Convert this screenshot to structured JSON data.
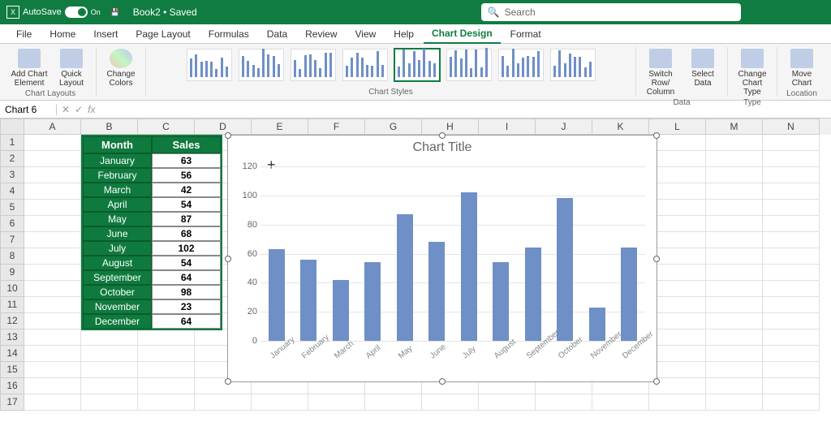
{
  "titlebar": {
    "autosave_label": "AutoSave",
    "autosave_state": "On",
    "doc_name": "Book2 • Saved",
    "search_placeholder": "Search"
  },
  "menubar": {
    "tabs": [
      "File",
      "Home",
      "Insert",
      "Page Layout",
      "Formulas",
      "Data",
      "Review",
      "View",
      "Help",
      "Chart Design",
      "Format"
    ],
    "active": "Chart Design"
  },
  "ribbon": {
    "groups": {
      "chart_layouts": {
        "label": "Chart Layouts",
        "buttons": [
          "Add Chart Element",
          "Quick Layout"
        ]
      },
      "change_colors": {
        "label": "",
        "buttons": [
          "Change Colors"
        ]
      },
      "chart_styles": {
        "label": "Chart Styles"
      },
      "data": {
        "label": "Data",
        "buttons": [
          "Switch Row/ Column",
          "Select Data"
        ]
      },
      "type": {
        "label": "Type",
        "buttons": [
          "Change Chart Type"
        ]
      },
      "location": {
        "label": "Location",
        "buttons": [
          "Move Chart"
        ]
      }
    }
  },
  "namebox": "Chart 6",
  "fx_label": "fx",
  "columns": [
    "A",
    "B",
    "C",
    "D",
    "E",
    "F",
    "G",
    "H",
    "I",
    "J",
    "K",
    "L",
    "M",
    "N"
  ],
  "row_numbers": [
    1,
    2,
    3,
    4,
    5,
    6,
    7,
    8,
    9,
    10,
    11,
    12,
    13,
    14,
    15,
    16,
    17
  ],
  "table": {
    "headers": [
      "Month",
      "Sales"
    ],
    "rows": [
      {
        "m": "January",
        "v": 63
      },
      {
        "m": "February",
        "v": 56
      },
      {
        "m": "March",
        "v": 42
      },
      {
        "m": "April",
        "v": 54
      },
      {
        "m": "May",
        "v": 87
      },
      {
        "m": "June",
        "v": 68
      },
      {
        "m": "July",
        "v": 102
      },
      {
        "m": "August",
        "v": 54
      },
      {
        "m": "September",
        "v": 64
      },
      {
        "m": "October",
        "v": 98
      },
      {
        "m": "November",
        "v": 23
      },
      {
        "m": "December",
        "v": 64
      }
    ]
  },
  "chart_data": {
    "type": "bar",
    "title": "Chart Title",
    "categories": [
      "January",
      "February",
      "March",
      "April",
      "May",
      "June",
      "July",
      "August",
      "September",
      "October",
      "November",
      "December"
    ],
    "values": [
      63,
      56,
      42,
      54,
      87,
      68,
      102,
      54,
      64,
      98,
      23,
      64
    ],
    "xlabel": "",
    "ylabel": "",
    "ylim": [
      0,
      120
    ],
    "yticks": [
      0,
      20,
      40,
      60,
      80,
      100,
      120
    ],
    "bar_color": "#6f8fc7"
  }
}
